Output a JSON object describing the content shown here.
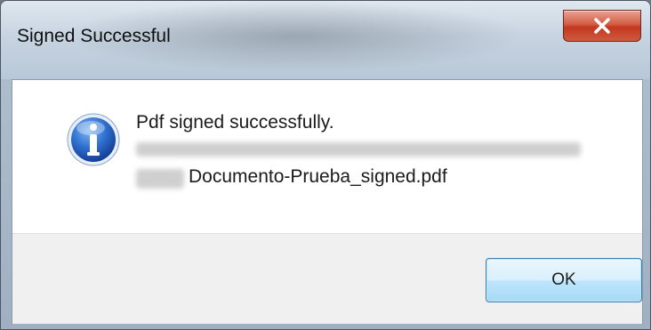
{
  "dialog": {
    "title": "Signed Successful",
    "message": "Pdf signed successfully.",
    "filename": "Documento-Prueba_signed.pdf",
    "icon": "info-icon"
  },
  "buttons": {
    "ok_label": "OK",
    "close_icon": "close-icon"
  }
}
